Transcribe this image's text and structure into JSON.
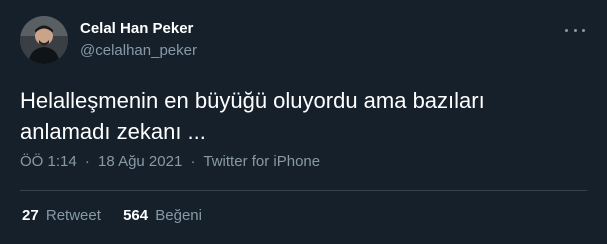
{
  "author": {
    "name": "Celal Han Peker",
    "handle": "@celalhan_peker",
    "avatar_icon": "user-avatar"
  },
  "tweet": {
    "text": "Helalleşmenin en büyüğü oluyordu ama bazıları\nanlamadı zekanı ...",
    "time": "ÖÖ 1:14",
    "date": "18 Ağu 2021",
    "source": "Twitter for iPhone",
    "separator": "·"
  },
  "stats": {
    "retweets_count": "27",
    "retweets_label": "Retweet",
    "likes_count": "564",
    "likes_label": "Beğeni"
  },
  "menu": {
    "icon": "more-horizontal-icon"
  },
  "colors": {
    "background": "#15202b",
    "text_primary": "#ffffff",
    "text_secondary": "#8899a6",
    "divider": "#38444d"
  }
}
